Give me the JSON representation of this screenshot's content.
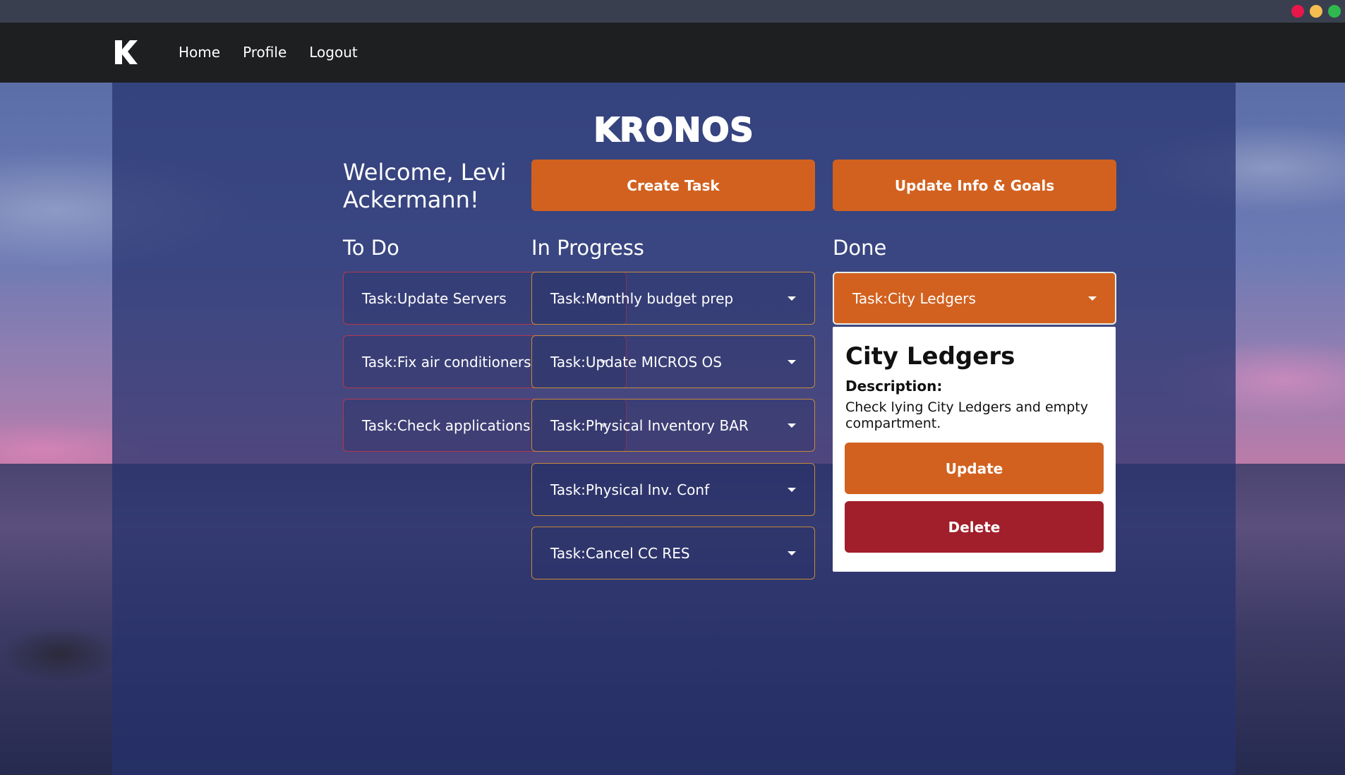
{
  "nav": {
    "logo": "K",
    "links": [
      "Home",
      "Profile",
      "Logout"
    ]
  },
  "header": {
    "brand": "KRONOS",
    "welcome": "Welcome, Levi Ackermann!",
    "create_task": "Create Task",
    "update_info": "Update Info & Goals"
  },
  "columns": {
    "todo": {
      "title": "To Do",
      "tasks": [
        "Task:Update Servers",
        "Task:Fix air conditioners",
        "Task:Check applications"
      ]
    },
    "in_progress": {
      "title": "In Progress",
      "tasks": [
        "Task:Monthly budget prep",
        "Task:Update MICROS OS",
        "Task:Physical Inventory BAR",
        "Task:Physical Inv. Conf",
        "Task:Cancel CC RES"
      ]
    },
    "done": {
      "title": "Done",
      "tasks": [
        "Task:City Ledgers"
      ]
    }
  },
  "detail": {
    "title": "City Ledgers",
    "description_label": "Description:",
    "description": "Check lying City Ledgers and empty compartment.",
    "update_label": "Update",
    "delete_label": "Delete"
  },
  "colors": {
    "accent": "#d2611f",
    "danger": "#a01f2a",
    "navbar": "#1d1f21",
    "todo_border": "#b2384f",
    "progress_border": "#c58a3a"
  }
}
